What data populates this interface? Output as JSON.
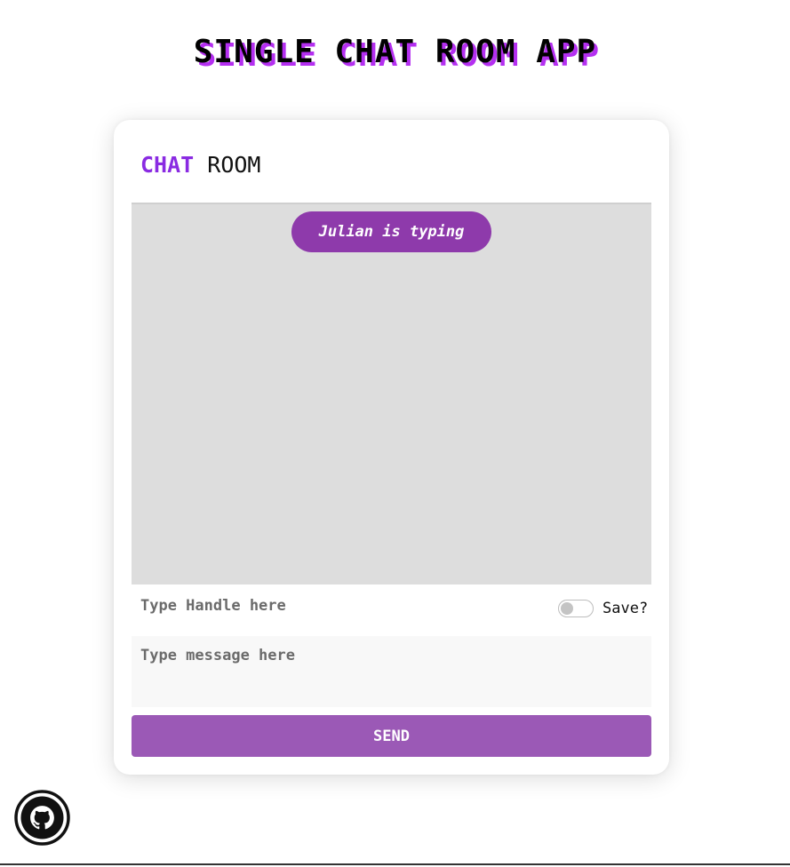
{
  "page": {
    "title": "SINGLE CHAT ROOM APP"
  },
  "room": {
    "heading_accent": "CHAT",
    "heading_rest": "ROOM"
  },
  "chat": {
    "typing_indicator": "Julian is typing"
  },
  "form": {
    "handle_placeholder": "Type Handle here",
    "handle_value": "",
    "save_label": "Save?",
    "save_checked": false,
    "message_placeholder": "Type message here",
    "message_value": "",
    "send_label": "SEND"
  },
  "footer": {
    "github_icon": "github-icon"
  },
  "colors": {
    "accent": "#8a2be2",
    "title_shadow": "#b42ff0",
    "typing_pill": "#8e3aab",
    "send_button": "#9b59b6",
    "chat_background": "#dddddd"
  }
}
